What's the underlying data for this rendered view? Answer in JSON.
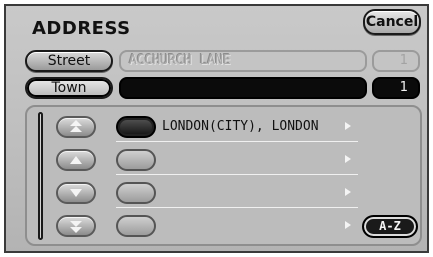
{
  "header": {
    "title": "ADDRESS",
    "cancel_label": "Cancel"
  },
  "street": {
    "label": "Street",
    "value": "ACCHURCH LANE",
    "count": "1"
  },
  "town": {
    "label": "Town",
    "value": "",
    "count": "1"
  },
  "list": {
    "rows": [
      {
        "text": "LONDON(CITY), LONDON",
        "selected": true
      },
      {
        "text": "",
        "selected": false
      },
      {
        "text": "",
        "selected": false
      },
      {
        "text": "",
        "selected": false
      }
    ],
    "az_label": "A-Z",
    "nav_buttons": [
      "page-up-icon",
      "up-icon",
      "down-icon",
      "page-down-icon"
    ]
  }
}
